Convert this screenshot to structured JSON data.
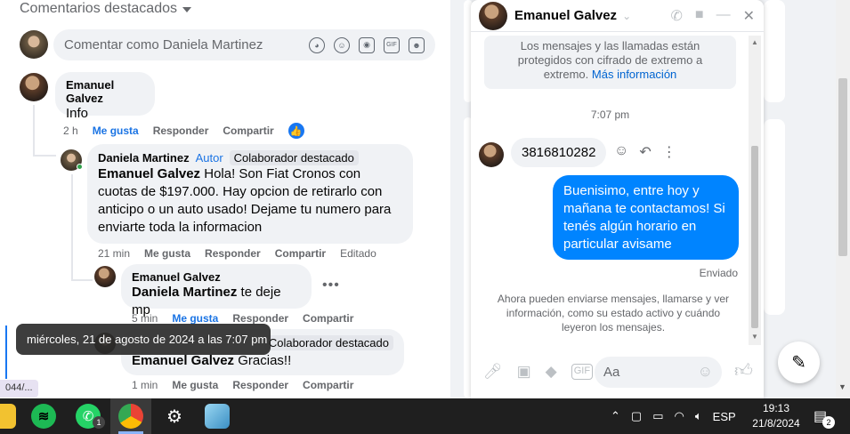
{
  "left": {
    "section_title": "Comentarios destacados",
    "comment_placeholder": "Comentar como Daniela Martinez",
    "c1": {
      "name": "Emanuel Galvez",
      "text": "Info",
      "time": "2 h",
      "like": "Me gusta",
      "reply": "Responder",
      "share": "Compartir"
    },
    "c2": {
      "name": "Daniela Martinez",
      "author_tag": "Autor",
      "collab_tag": "Colaborador destacado",
      "mention": "Emanuel Galvez",
      "text": " Hola! Son Fiat Cronos con cuotas de $197.000. Hay opcion de retirarlo con anticipo o un auto usado! Dejame tu numero para enviarte toda la informacion",
      "time": "21 min",
      "like": "Me gusta",
      "reply": "Responder",
      "share": "Compartir",
      "edited": "Editado"
    },
    "c3": {
      "name": "Emanuel Galvez",
      "mention": "Daniela Martinez",
      "text": " te deje mp",
      "time": "5 min",
      "like": "Me gusta",
      "reply": "Responder",
      "share": "Compartir"
    },
    "c4": {
      "collab_tag": "Colaborador destacado",
      "mention": "Emanuel Galvez",
      "text": " Gracias!!",
      "time": "1 min",
      "like": "Me gusta",
      "reply": "Responder",
      "share": "Compartir"
    },
    "tooltip": "miércoles, 21 de agosto de 2024 a las 7:07 pm",
    "url_fragment": "044/..."
  },
  "chat": {
    "name": "Emanuel Galvez",
    "notice": "Los mensajes y las llamadas están protegidos con cifrado de extremo a extremo.",
    "notice_link": "Más información",
    "time": "7:07 pm",
    "incoming": "3816810282",
    "outgoing": "Buenisimo, entre hoy y mañana te contactamos! Si tenés algún horario en particular avisame",
    "status": "Enviado",
    "info": "Ahora pueden enviarse mensajes, llamarse y ver información, como su estado activo y cuándo leyeron los mensajes.",
    "composer_placeholder": "Aa"
  },
  "taskbar": {
    "lang": "ESP",
    "clock_time": "19:13",
    "clock_date": "21/8/2024",
    "whatsapp_badge": "1",
    "notif_badge": "2"
  },
  "colors": {
    "accent": "#1877f2",
    "outgoing_bubble": "#0084ff",
    "taskbar": "#1f1f1f"
  }
}
